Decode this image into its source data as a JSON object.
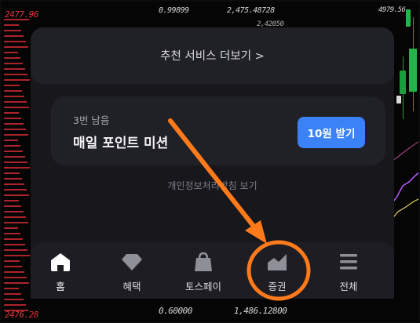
{
  "background": {
    "top_left_value": "2477.96",
    "top_values": [
      "0.99899",
      "2,475.48728",
      "4979.56"
    ],
    "top_values_row2": [
      "2,42050"
    ],
    "bottom_left_value": "2476.28",
    "bottom_values": [
      "0.60000",
      "1,486.12800"
    ],
    "bottom_partial": "1,486.12800"
  },
  "more_services": {
    "label": "추천 서비스 더보기 >"
  },
  "mission": {
    "remaining": "3번 남음",
    "title": "매일 포인트 미션",
    "button_label": "10원 받기"
  },
  "privacy_link": "개인정보처리방침 보기",
  "tabbar": {
    "items": [
      {
        "label": "홈",
        "icon": "home-icon",
        "active": true
      },
      {
        "label": "혜택",
        "icon": "diamond-icon",
        "active": false
      },
      {
        "label": "토스페이",
        "icon": "shopping-bag-icon",
        "active": false
      },
      {
        "label": "증권",
        "icon": "chart-icon",
        "active": false
      },
      {
        "label": "전체",
        "icon": "menu-icon",
        "active": false
      }
    ]
  },
  "annotation": {
    "color": "#ff7a1a",
    "highlighted_tab": "증권"
  },
  "colors": {
    "accent_button": "#3a82f5",
    "card_bg": "#202027",
    "panel_bg": "#17171c"
  }
}
